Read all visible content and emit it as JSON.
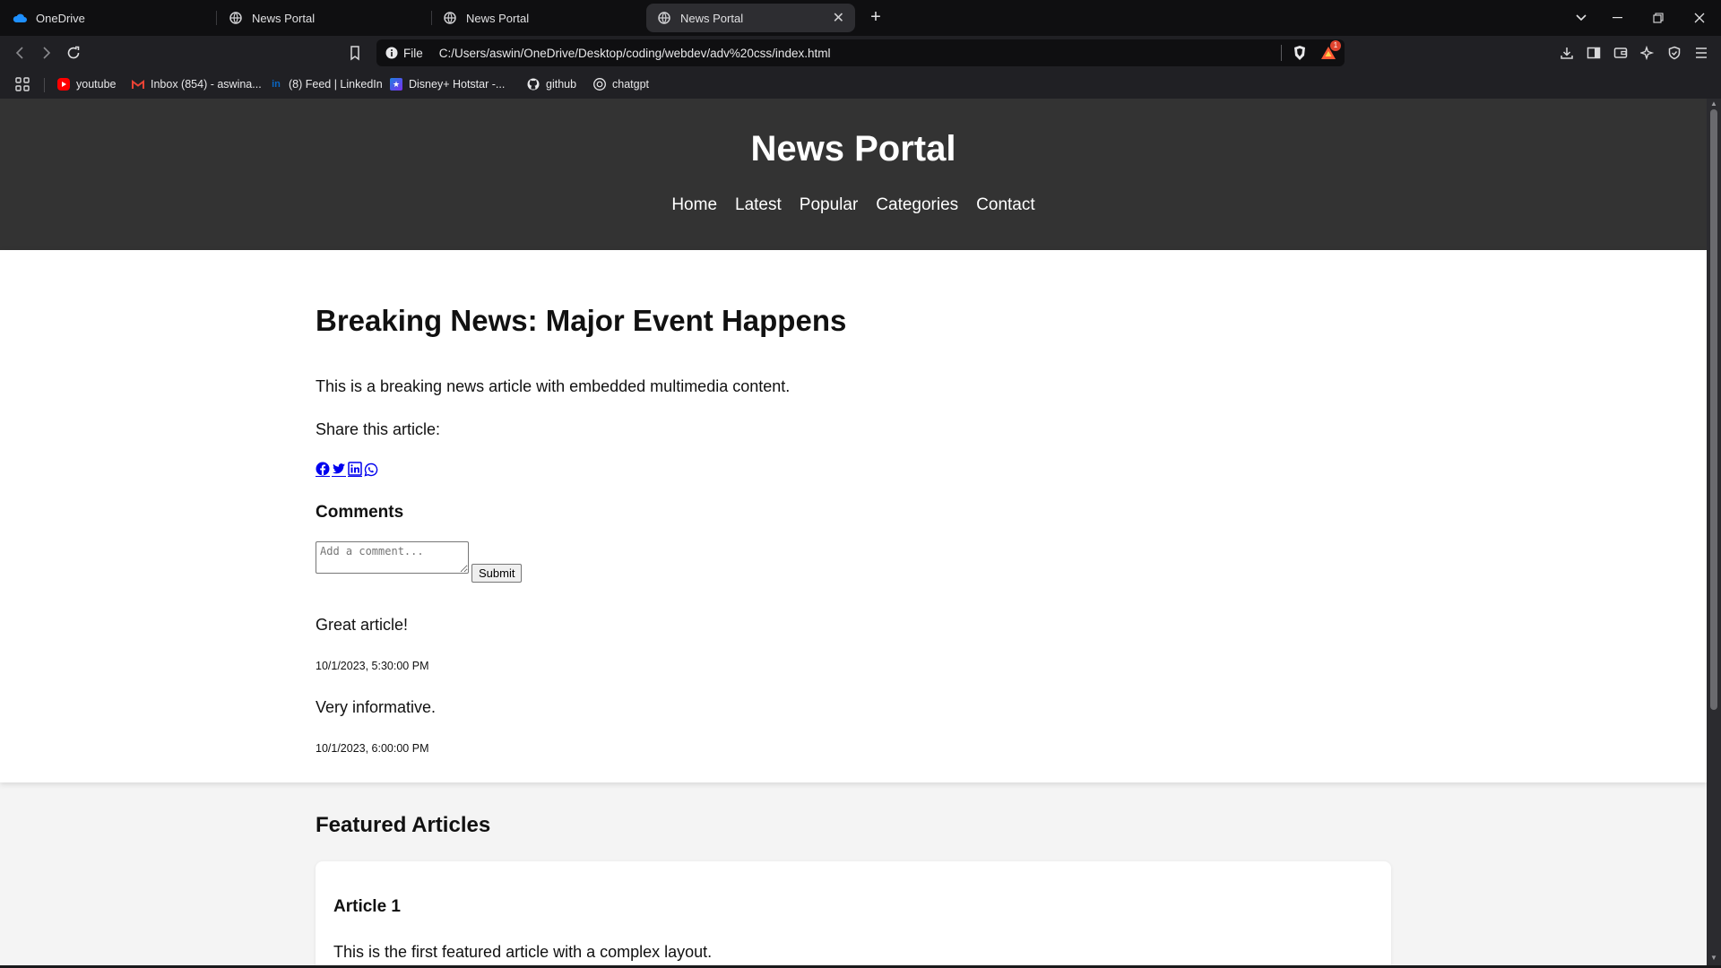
{
  "browser": {
    "tabs": [
      {
        "title": "OneDrive",
        "icon": "onedrive-icon",
        "active": false
      },
      {
        "title": "News Portal",
        "icon": "globe-icon",
        "active": false
      },
      {
        "title": "News Portal",
        "icon": "globe-icon",
        "active": false
      },
      {
        "title": "News Portal",
        "icon": "globe-icon",
        "active": true
      }
    ],
    "address": {
      "scheme": "File",
      "url": "C:/Users/aswin/OneDrive/Desktop/coding/webdev/adv%20css/index.html"
    },
    "rewards_badge": "1",
    "bookmarks": [
      {
        "label": "youtube",
        "icon": "youtube-icon",
        "color": "#ff0000"
      },
      {
        "label": "Inbox (854) - aswina...",
        "icon": "gmail-icon",
        "color": "#ea4335"
      },
      {
        "label": "(8) Feed | LinkedIn",
        "icon": "linkedin-icon",
        "color": "#0a66c2"
      },
      {
        "label": "Disney+ Hotstar -...",
        "icon": "hotstar-icon",
        "color": "#1f80e0"
      },
      {
        "label": "github",
        "icon": "github-icon",
        "color": "#ffffff"
      },
      {
        "label": "chatgpt",
        "icon": "chatgpt-icon",
        "color": "#ffffff"
      }
    ]
  },
  "site": {
    "title": "News Portal",
    "nav": [
      "Home",
      "Latest",
      "Popular",
      "Categories",
      "Contact"
    ]
  },
  "article": {
    "headline": "Breaking News: Major Event Happens",
    "lead": "This is a breaking news article with embedded multimedia content.",
    "share_label": "Share this article:",
    "share_icons": [
      "facebook-icon",
      "twitter-icon",
      "linkedin-icon",
      "whatsapp-icon"
    ],
    "comments_heading": "Comments",
    "comment_placeholder": "Add a comment...",
    "submit_label": "Submit",
    "comments": [
      {
        "text": "Great article!",
        "time": "10/1/2023, 5:30:00 PM"
      },
      {
        "text": "Very informative.",
        "time": "10/1/2023, 6:00:00 PM"
      }
    ]
  },
  "featured": {
    "heading": "Featured Articles",
    "articles": [
      {
        "title": "Article 1",
        "summary": "This is the first featured article with a complex layout."
      }
    ]
  },
  "colors": {
    "header_bg": "#333333",
    "page_bg": "#f4f4f4",
    "link": "#0000ee"
  }
}
